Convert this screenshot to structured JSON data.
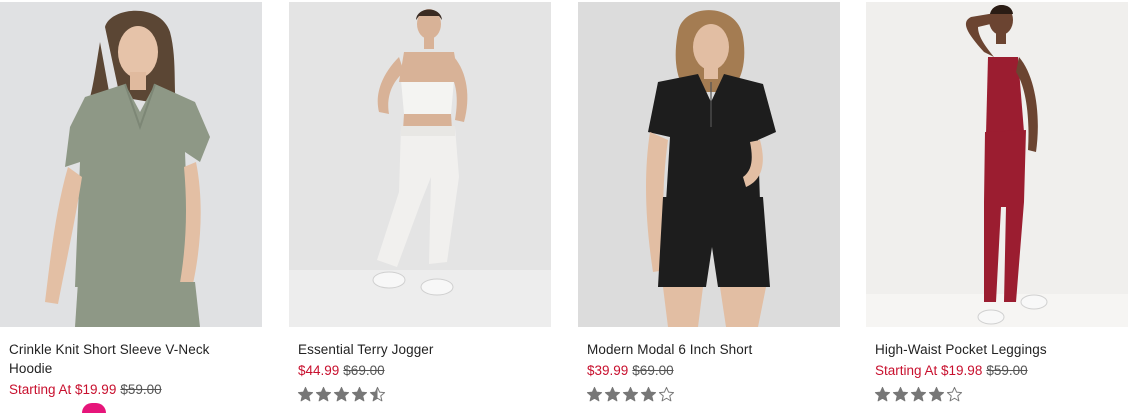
{
  "products": [
    {
      "name": "Crinkle Knit Short Sleeve V-Neck Hoodie",
      "price": "Starting At $19.99",
      "original_price": "$59.00",
      "rating": null,
      "image_alt": "crinkle knit short sleeve v-neck hoodie"
    },
    {
      "name": "Essential Terry Jogger",
      "price": "$44.99",
      "original_price": "$69.00",
      "rating": 4.5,
      "image_alt": "essential terry jogger"
    },
    {
      "name": "Modern Modal 6 Inch Short",
      "price": "$39.99",
      "original_price": "$69.00",
      "rating": 4,
      "image_alt": "modern modal 6 inch short"
    },
    {
      "name": "High-Waist Pocket Leggings",
      "price": "Starting At $19.98",
      "original_price": "$59.00",
      "rating": 4,
      "image_alt": "high-waist pocket leggings"
    }
  ],
  "colors": {
    "sale_price": "#c8102e",
    "star_fill": "#777777",
    "star_empty": "#777777",
    "swatch_accent": "#e6157a"
  },
  "icons": {
    "rating": "star-icon"
  }
}
